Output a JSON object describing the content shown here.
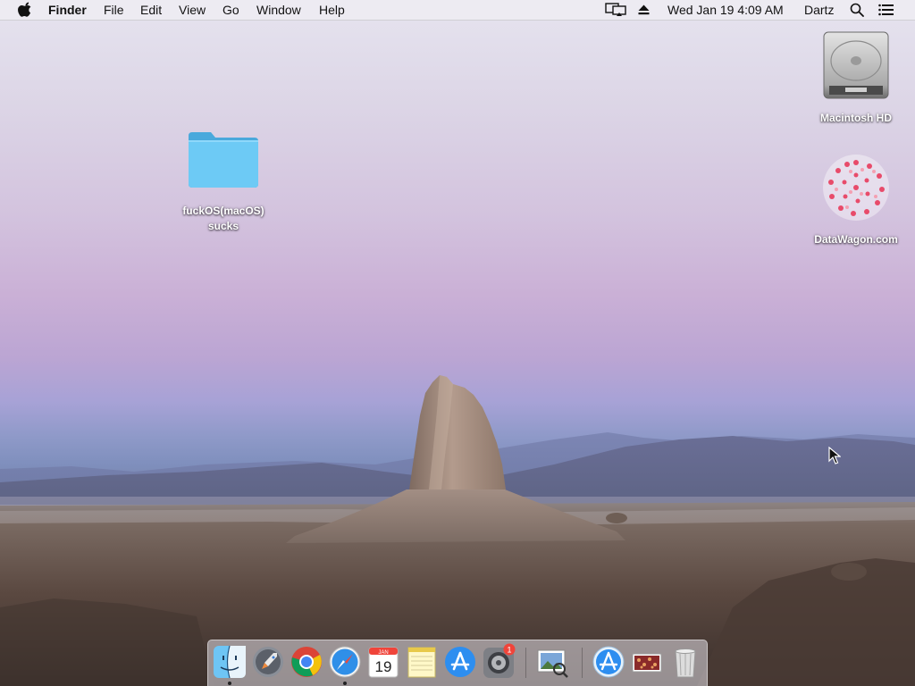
{
  "menubar": {
    "app_name": "Finder",
    "menus": [
      "File",
      "Edit",
      "View",
      "Go",
      "Window",
      "Help"
    ],
    "clock": "Wed Jan 19  4:09 AM",
    "user": "Dartz",
    "icons": [
      "apple-icon",
      "airplay-display-icon",
      "eject-icon",
      "spotlight-search-icon",
      "notification-center-icon"
    ]
  },
  "desktop": {
    "folder_label_line1": "fuckOS(macOS)",
    "folder_label_line2": "sucks",
    "drive_label": "Macintosh HD",
    "web_label": "DataWagon.com"
  },
  "dock": {
    "apps": [
      "Finder",
      "Launchpad",
      "Google Chrome",
      "Safari",
      "Calendar",
      "Notes",
      "App Store",
      "System Preferences",
      "Preview",
      "Applications",
      "Photo Stack",
      "Trash"
    ],
    "calendar_month": "JAN",
    "calendar_day": "19",
    "badge_count": "1"
  },
  "colors": {
    "folder_blue": "#5fc1f1",
    "badge_red": "#f0443a",
    "sky_top": "#e6e4ef",
    "sky_purple": "#bba5d3"
  }
}
